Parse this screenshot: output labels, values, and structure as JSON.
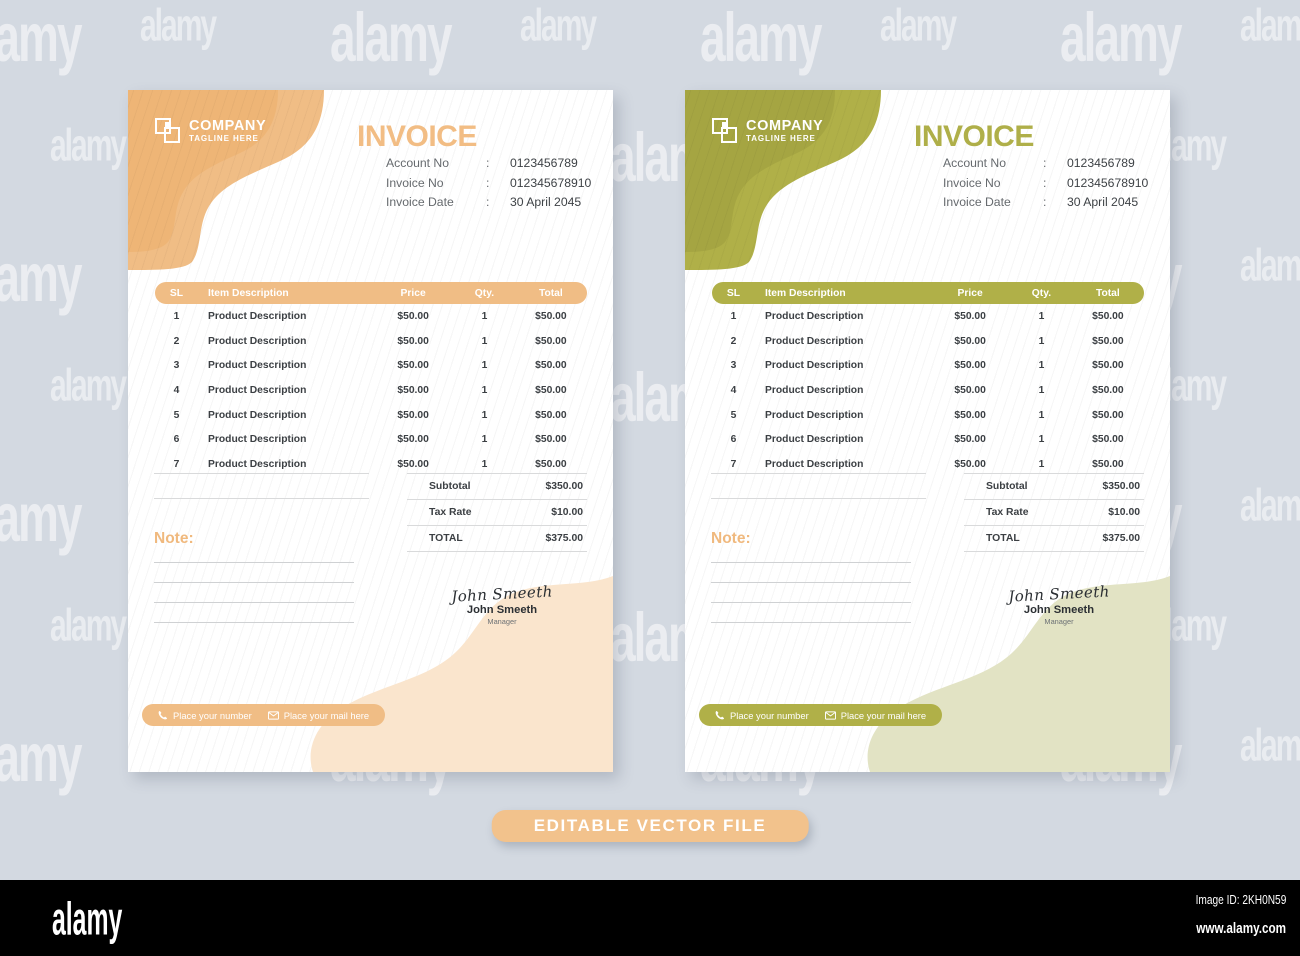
{
  "background_color": "#d3d9e1",
  "banner": {
    "label": "EDITABLE VECTOR  FILE",
    "color": "#f2c28c"
  },
  "watermark": {
    "text": "alamy"
  },
  "alamy": {
    "logo": "alamy",
    "image_id": "Image ID: 2KH0N59",
    "url": "www.alamy.com"
  },
  "shared": {
    "logo": {
      "name": "COMPANY",
      "tagline": "TAGLINE HERE"
    },
    "title": "INVOICE",
    "meta": [
      {
        "key": "Account No",
        "colon": ":",
        "value": "0123456789"
      },
      {
        "key": "Invoice No",
        "colon": ":",
        "value": "012345678910"
      },
      {
        "key": "Invoice Date",
        "colon": ":",
        "value": "30 April 2045"
      }
    ],
    "table": {
      "headers": [
        "SL",
        "Item Description",
        "Price",
        "Qty.",
        "Total"
      ],
      "rows": [
        {
          "sl": "1",
          "desc": "Product Description",
          "price": "$50.00",
          "qty": "1",
          "total": "$50.00"
        },
        {
          "sl": "2",
          "desc": "Product Description",
          "price": "$50.00",
          "qty": "1",
          "total": "$50.00"
        },
        {
          "sl": "3",
          "desc": "Product Description",
          "price": "$50.00",
          "qty": "1",
          "total": "$50.00"
        },
        {
          "sl": "4",
          "desc": "Product Description",
          "price": "$50.00",
          "qty": "1",
          "total": "$50.00"
        },
        {
          "sl": "5",
          "desc": "Product Description",
          "price": "$50.00",
          "qty": "1",
          "total": "$50.00"
        },
        {
          "sl": "6",
          "desc": "Product Description",
          "price": "$50.00",
          "qty": "1",
          "total": "$50.00"
        },
        {
          "sl": "7",
          "desc": "Product Description",
          "price": "$50.00",
          "qty": "1",
          "total": "$50.00"
        }
      ]
    },
    "totals": [
      {
        "label": "Subtotal",
        "value": "$350.00"
      },
      {
        "label": "Tax Rate",
        "value": "$10.00"
      },
      {
        "label": "TOTAL",
        "value": "$375.00"
      }
    ],
    "note": {
      "heading": "Note:",
      "lines": 4
    },
    "signature": {
      "script": "John Smeeth",
      "name": "John Smeeth",
      "role": "Manager"
    },
    "footer": {
      "phone": "Place your number",
      "mail": "Place your mail here"
    }
  },
  "variants": [
    {
      "id": "orange",
      "accent": "#f0bd85",
      "accent_deep": "#ecae6a",
      "accent_soft": "#fae5cd",
      "title_color": "#f2bd84",
      "note_color": "#f0b97e"
    },
    {
      "id": "green",
      "accent": "#b0b048",
      "accent_deep": "#a5a540",
      "accent_soft": "#e2e3c4",
      "title_color": "#afaf49",
      "note_color": "#f0b97e"
    }
  ]
}
